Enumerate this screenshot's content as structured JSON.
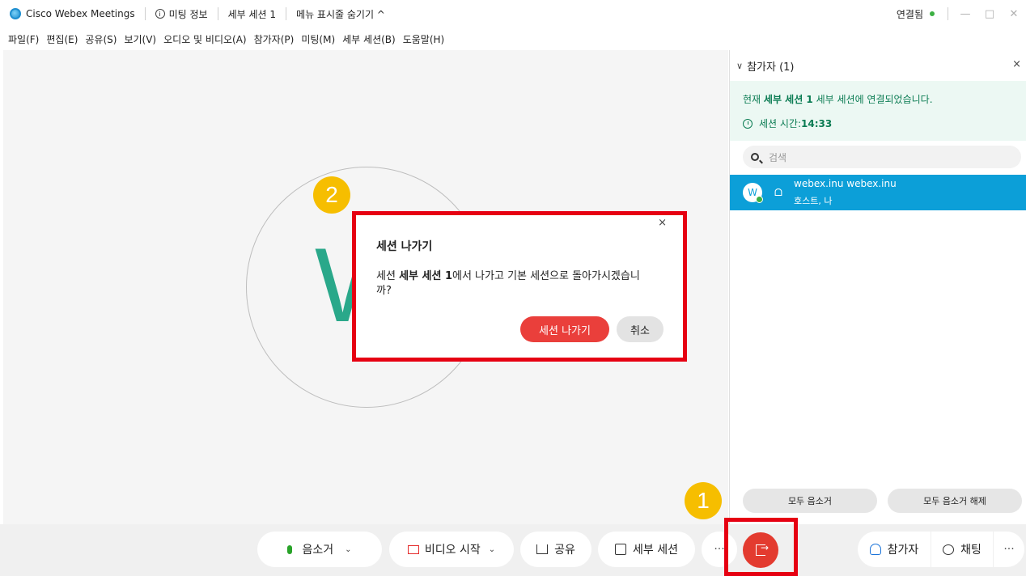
{
  "titlebar": {
    "app_name": "Cisco Webex Meetings",
    "meeting_info": "미팅 정보",
    "session_name": "세부 세션 1",
    "hide_menu": "메뉴 표시줄 숨기기 ^",
    "status": "연결됨",
    "minimize": "—",
    "maximize": "□",
    "close": "✕"
  },
  "menu": {
    "items": [
      "파일(F)",
      "편집(E)",
      "공유(S)",
      "보기(V)",
      "오디오 및 비디오(A)",
      "참가자(P)",
      "미팅(M)",
      "세부 세션(B)",
      "도움말(H)"
    ]
  },
  "stage": {
    "avatar_letter": "W"
  },
  "steps": {
    "one": "1",
    "two": "2"
  },
  "dialog": {
    "close": "×",
    "title": "세션 나가기",
    "msg_prefix": "세션 ",
    "msg_bold": "세부 세션 1",
    "msg_suffix": "에서 나가고 기본 세션으로 돌아가시겠습니까?",
    "leave_label": "세션 나가기",
    "cancel_label": "취소"
  },
  "panel": {
    "chevron": "∨",
    "title": "참가자 (1)",
    "close": "×",
    "session_prefix": "현재 ",
    "session_bold": "세부 세션 1",
    "session_suffix": " 세부 세션에 연결되었습니다.",
    "time_label": "세션 시간: ",
    "time_value": "14:33",
    "search_placeholder": "검색",
    "participant": {
      "avatar": "W",
      "name": "webex.inu webex.inu",
      "role": "호스트, 나"
    },
    "mute_all": "모두 음소거",
    "unmute_all": "모두 음소거 해제"
  },
  "toolbar": {
    "mute": "음소거",
    "video": "비디오 시작",
    "share": "공유",
    "breakout": "세부 세션",
    "more": "···",
    "participants": "참가자",
    "chat": "채팅",
    "more_right": "···",
    "caret": "⌄"
  },
  "colors": {
    "accent_blue": "#0c9fd8",
    "leave_red": "#e33b2f",
    "annotation_red": "#e60012",
    "step_yellow": "#f6be00",
    "session_green": "#0b7c53"
  }
}
